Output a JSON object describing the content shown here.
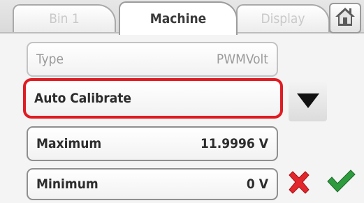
{
  "tabs": [
    {
      "label": "Bin 1"
    },
    {
      "label": "Machine"
    },
    {
      "label": "Display"
    }
  ],
  "fields": {
    "type": {
      "label": "Type",
      "value": "PWMVolt"
    },
    "auto_calibrate": {
      "label": "Auto Calibrate"
    },
    "maximum": {
      "label": "Maximum",
      "value": "11.9996 V"
    },
    "minimum": {
      "label": "Minimum",
      "value": "0 V"
    }
  },
  "icons": {
    "home": "home-icon",
    "dropdown": "triangle-down-icon",
    "cancel": "red-x-icon",
    "confirm": "green-check-icon"
  },
  "colors": {
    "selection_border": "#e01b22",
    "cancel_red": "#e3262c",
    "confirm_green": "#2e9b3e"
  }
}
